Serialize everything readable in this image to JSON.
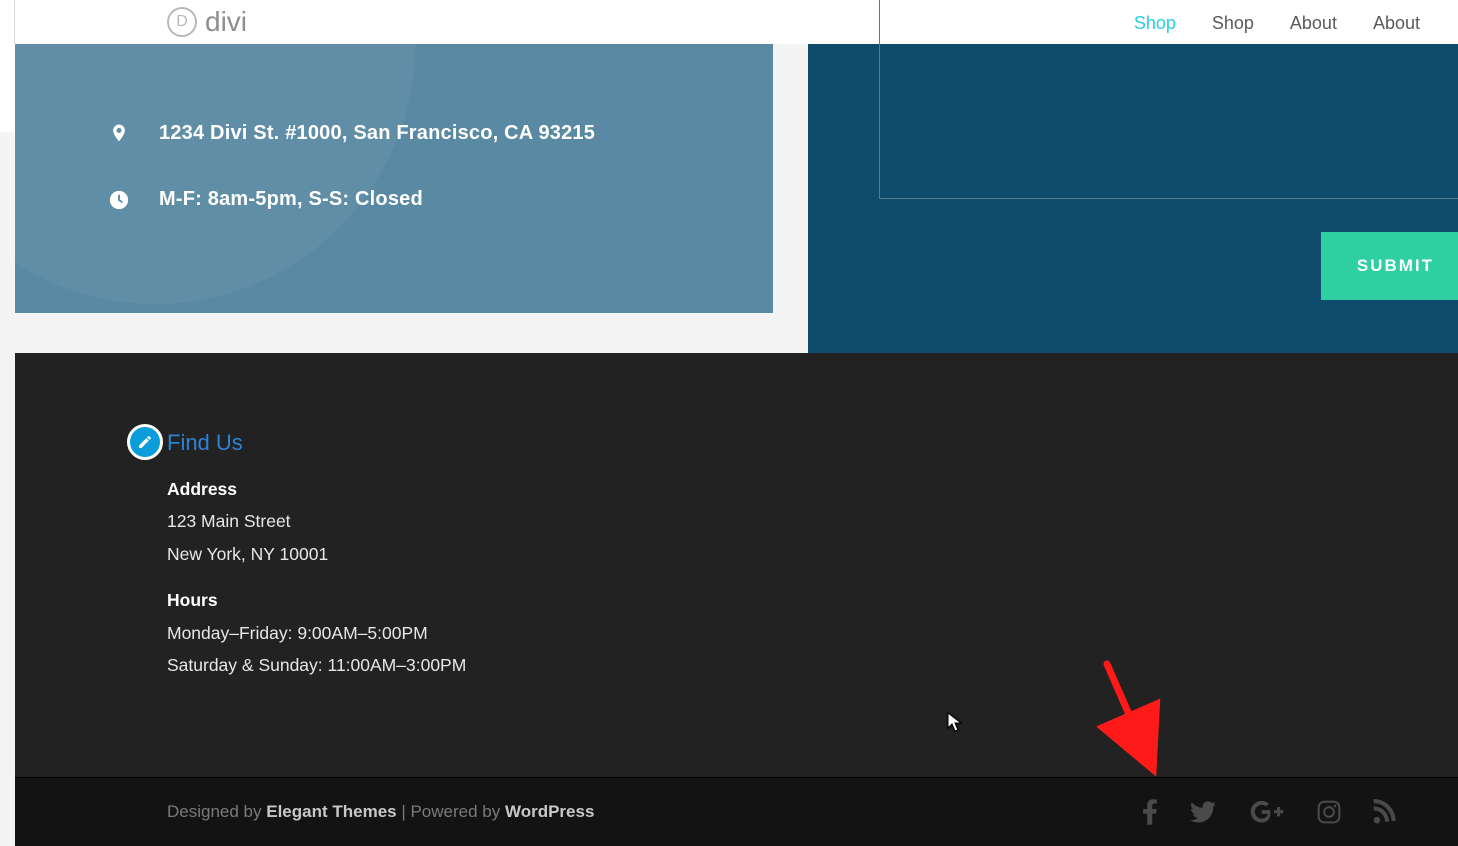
{
  "header": {
    "logo_letter": "D",
    "logo_text": "divi",
    "nav": [
      {
        "label": "Shop",
        "active": true
      },
      {
        "label": "Shop",
        "active": false
      },
      {
        "label": "About",
        "active": false
      },
      {
        "label": "About",
        "active": false
      }
    ]
  },
  "contact_card": {
    "address": "1234 Divi St. #1000, San Francisco, CA 93215",
    "hours": "M-F: 8am-5pm, S-S: Closed"
  },
  "form": {
    "submit_label": "SUBMIT"
  },
  "footer": {
    "title": "Find Us",
    "address_label": "Address",
    "address_line1": "123 Main Street",
    "address_line2": "New York, NY 10001",
    "hours_label": "Hours",
    "hours_line1": "Monday–Friday: 9:00AM–5:00PM",
    "hours_line2": "Saturday & Sunday: 11:00AM–3:00PM"
  },
  "bottom": {
    "designed_prefix": "Designed by ",
    "designed_link": "Elegant Themes",
    "powered_sep": " | Powered by ",
    "powered_link": "WordPress"
  }
}
